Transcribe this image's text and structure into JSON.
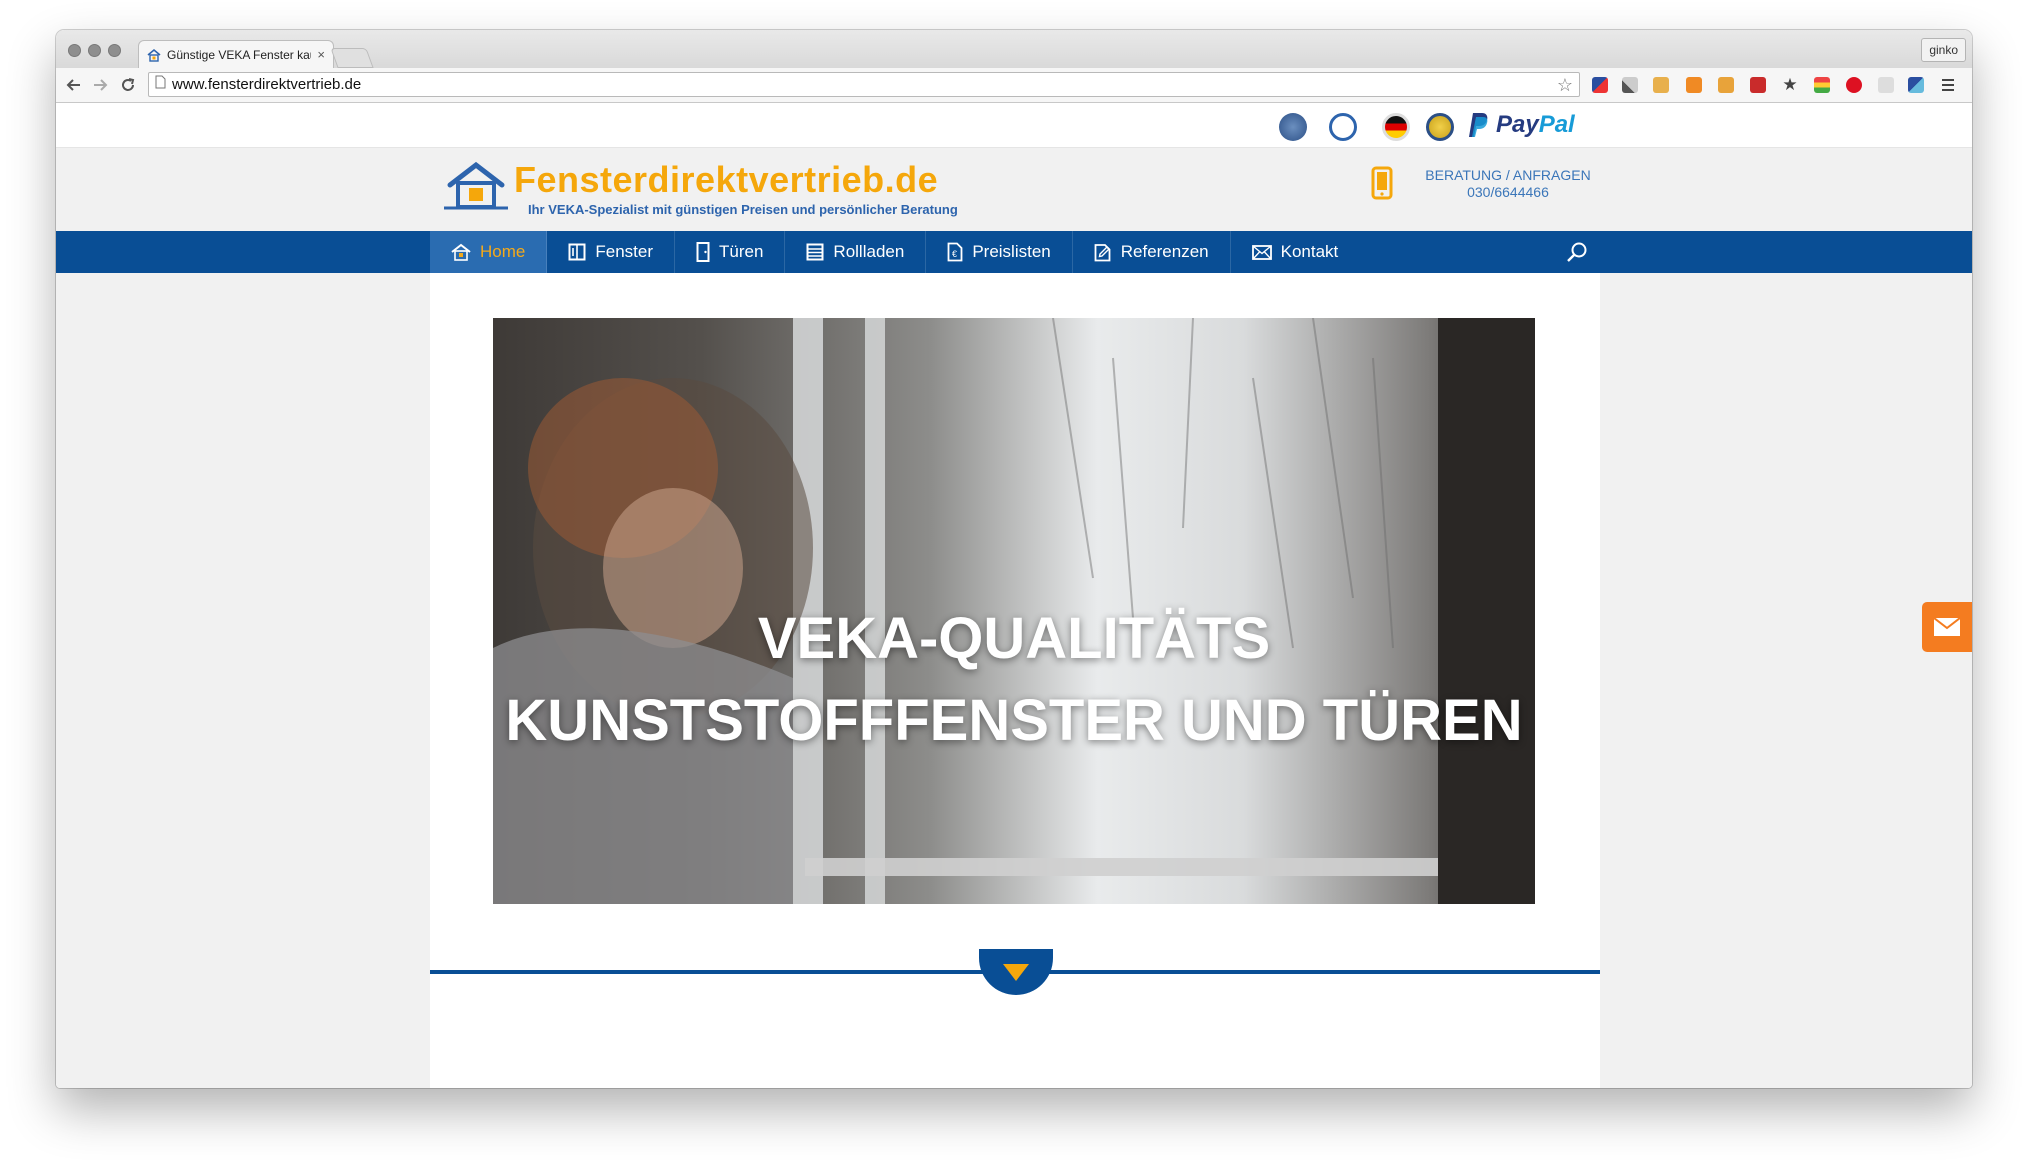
{
  "browser": {
    "tab_title": "Günstige VEKA Fenster kau",
    "tab_close": "×",
    "profile": "ginko",
    "url": "www.fensterdirektvertrieb.de",
    "star": "☆"
  },
  "topstrip": {
    "paypal_pay": "Pay",
    "paypal_pal": "Pal"
  },
  "header": {
    "logo_title": "Fensterdirektvertrieb.de",
    "logo_subtitle": "Ihr VEKA-Spezialist mit günstigen Preisen und persönlicher Beratung",
    "contact_label": "BERATUNG / ANFRAGEN",
    "contact_phone": "030/6644466"
  },
  "nav": {
    "items": [
      {
        "label": "Home",
        "icon": "home-icon"
      },
      {
        "label": "Fenster",
        "icon": "window-icon"
      },
      {
        "label": "Türen",
        "icon": "door-icon"
      },
      {
        "label": "Rollladen",
        "icon": "shutter-icon"
      },
      {
        "label": "Preislisten",
        "icon": "pricelist-icon"
      },
      {
        "label": "Referenzen",
        "icon": "references-icon"
      },
      {
        "label": "Kontakt",
        "icon": "envelope-icon"
      }
    ]
  },
  "hero": {
    "line1": "VEKA-QUALITÄTS",
    "line2": "KUNSTSTOFFFENSTER UND TÜREN"
  },
  "colors": {
    "brand_blue": "#094e95",
    "brand_orange": "#f5a70b",
    "active_nav": "#2a6cb1",
    "mail_tab": "#f47c20"
  }
}
